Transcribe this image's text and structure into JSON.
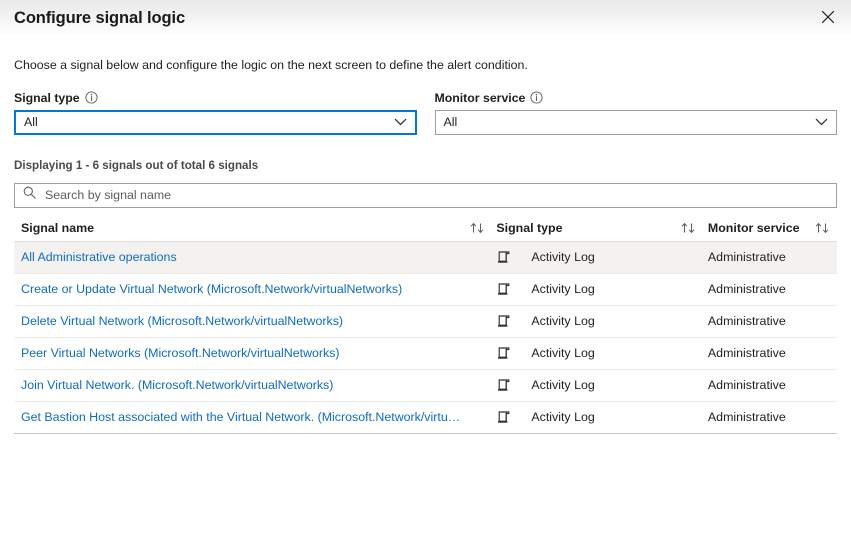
{
  "header": {
    "title": "Configure signal logic",
    "close_label": "Close",
    "close_icon": "close-icon"
  },
  "intro": {
    "text": "Choose a signal below and configure the logic on the next screen to define the alert condition."
  },
  "filters": {
    "signal_type": {
      "label": "Signal type",
      "info_icon": "info-icon",
      "value": "All",
      "chevron_icon": "chevron-down-icon",
      "focused": true
    },
    "monitor_service": {
      "label": "Monitor service",
      "info_icon": "info-icon",
      "value": "All",
      "chevron_icon": "chevron-down-icon",
      "focused": false
    }
  },
  "results": {
    "displaying_text": "Displaying 1 - 6 signals out of total 6 signals"
  },
  "search": {
    "placeholder": "Search by signal name",
    "value": "",
    "icon": "search-icon"
  },
  "table": {
    "columns": [
      {
        "label": "Signal name",
        "sort_icon": "sort-ascending-descending-icon"
      },
      {
        "label": "Signal type",
        "sort_icon": "sort-ascending-descending-icon"
      },
      {
        "label": "Monitor service",
        "sort_icon": "sort-ascending-descending-icon"
      }
    ],
    "rows": [
      {
        "name": "All Administrative operations",
        "type_icon": "activity-log-icon",
        "type": "Activity Log",
        "service": "Administrative",
        "hovered": true
      },
      {
        "name": "Create or Update Virtual Network (Microsoft.Network/virtualNetworks)",
        "type_icon": "activity-log-icon",
        "type": "Activity Log",
        "service": "Administrative",
        "hovered": false
      },
      {
        "name": "Delete Virtual Network (Microsoft.Network/virtualNetworks)",
        "type_icon": "activity-log-icon",
        "type": "Activity Log",
        "service": "Administrative",
        "hovered": false
      },
      {
        "name": "Peer Virtual Networks (Microsoft.Network/virtualNetworks)",
        "type_icon": "activity-log-icon",
        "type": "Activity Log",
        "service": "Administrative",
        "hovered": false
      },
      {
        "name": "Join Virtual Network. (Microsoft.Network/virtualNetworks)",
        "type_icon": "activity-log-icon",
        "type": "Activity Log",
        "service": "Administrative",
        "hovered": false
      },
      {
        "name": "Get Bastion Host associated with the Virtual Network. (Microsoft.Network/virtualNet...",
        "type_icon": "activity-log-icon",
        "type": "Activity Log",
        "service": "Administrative",
        "hovered": false
      }
    ]
  },
  "colors": {
    "link": "#0f6cbd",
    "accent": "#0078d4",
    "border": "#a19f9d",
    "row_hover": "#f3f2f1",
    "text": "#201f1e",
    "muted": "#605e5c"
  }
}
